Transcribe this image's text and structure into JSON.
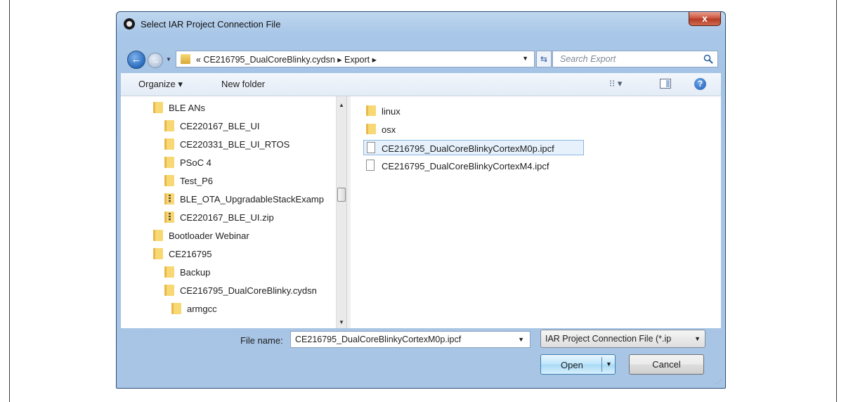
{
  "window": {
    "title": "Select IAR Project Connection File",
    "close_label": "x"
  },
  "address": {
    "path": "« CE216795_DualCoreBlinky.cydsn ▸ Export ▸",
    "search_placeholder": "Search Export"
  },
  "toolbar": {
    "organize_label": "Organize ▾",
    "new_folder_label": "New folder",
    "views_label": "⁝⁝ ▾",
    "help_label": "?"
  },
  "tree": {
    "items": [
      {
        "label": "BLE ANs",
        "kind": "folder"
      },
      {
        "label": "CE220167_BLE_UI",
        "kind": "folder"
      },
      {
        "label": "CE220331_BLE_UI_RTOS",
        "kind": "folder"
      },
      {
        "label": "PSoC 4",
        "kind": "folder"
      },
      {
        "label": "Test_P6",
        "kind": "folder"
      },
      {
        "label": "BLE_OTA_UpgradableStackExamp",
        "kind": "zip"
      },
      {
        "label": "CE220167_BLE_UI.zip",
        "kind": "zip"
      },
      {
        "label": "Bootloader Webinar",
        "kind": "folder"
      },
      {
        "label": "CE216795",
        "kind": "folder"
      },
      {
        "label": "Backup",
        "kind": "folder"
      },
      {
        "label": "CE216795_DualCoreBlinky.cydsn",
        "kind": "folder"
      },
      {
        "label": "armgcc",
        "kind": "folder"
      }
    ]
  },
  "files": {
    "items": [
      {
        "label": "linux",
        "kind": "folder"
      },
      {
        "label": "osx",
        "kind": "folder"
      },
      {
        "label": "CE216795_DualCoreBlinkyCortexM0p.ipcf",
        "kind": "file",
        "selected": true
      },
      {
        "label": "CE216795_DualCoreBlinkyCortexM4.ipcf",
        "kind": "file"
      }
    ]
  },
  "bottom": {
    "file_name_label": "File name:",
    "file_name_value": "CE216795_DualCoreBlinkyCortexM0p.ipcf",
    "filter_value": "IAR Project Connection File (*.ip",
    "open_label": "Open",
    "cancel_label": "Cancel"
  }
}
